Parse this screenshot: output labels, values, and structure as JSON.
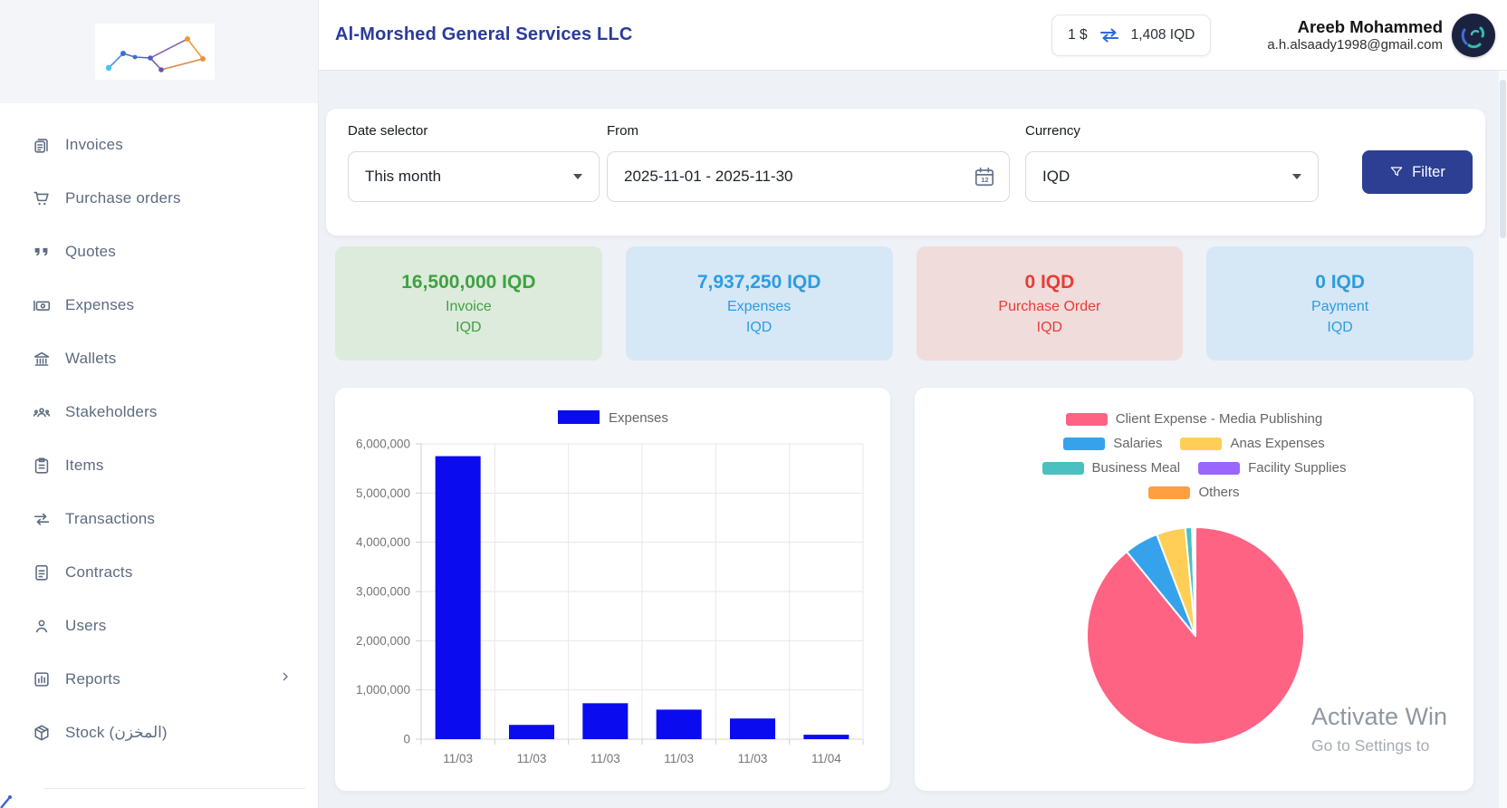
{
  "colors": {
    "title_navy": "#2a3b9c",
    "filter_button": "#2c3f92",
    "bar_blue": "#0b0bf0",
    "stat_green": "#3fa142",
    "stat_blue": "#2d9ce0",
    "stat_red": "#e83d35",
    "pie_palette": [
      "#FF6384",
      "#36A2EB",
      "#FFCE56",
      "#4BC0C0",
      "#9966FF",
      "#FF9F40"
    ]
  },
  "header": {
    "company_name": "Al-Morshed General Services LLC",
    "exchange_rate": {
      "left": "1 $",
      "right": "1,408 IQD"
    },
    "user": {
      "name": "Areeb Mohammed",
      "email": "a.h.alsaady1998@gmail.com"
    }
  },
  "sidebar": {
    "items": [
      {
        "label": "Invoices",
        "icon": "invoices-icon"
      },
      {
        "label": "Purchase orders",
        "icon": "purchase-orders-icon"
      },
      {
        "label": "Quotes",
        "icon": "quotes-icon"
      },
      {
        "label": "Expenses",
        "icon": "expenses-icon"
      },
      {
        "label": "Wallets",
        "icon": "wallets-icon"
      },
      {
        "label": "Stakeholders",
        "icon": "stakeholders-icon"
      },
      {
        "label": "Items",
        "icon": "items-icon"
      },
      {
        "label": "Transactions",
        "icon": "transactions-icon"
      },
      {
        "label": "Contracts",
        "icon": "contracts-icon"
      },
      {
        "label": "Users",
        "icon": "users-icon"
      },
      {
        "label": "Reports",
        "icon": "reports-icon",
        "chevron": true
      },
      {
        "label": "Stock (المخزن)",
        "icon": "stock-icon"
      }
    ]
  },
  "filters": {
    "date_selector": {
      "label": "Date selector",
      "value": "This month"
    },
    "from": {
      "label": "From",
      "value": "2025-11-01 - 2025-11-30"
    },
    "currency": {
      "label": "Currency",
      "value": "IQD"
    },
    "filter_button_label": "Filter"
  },
  "stat_cards": [
    {
      "value": "16,500,000 IQD",
      "label": "Invoice",
      "currency": "IQD",
      "theme": "green"
    },
    {
      "value": "7,937,250 IQD",
      "label": "Expenses",
      "currency": "IQD",
      "theme": "blue"
    },
    {
      "value": "0 IQD",
      "label": "Purchase Order",
      "currency": "IQD",
      "theme": "red"
    },
    {
      "value": "0 IQD",
      "label": "Payment",
      "currency": "IQD",
      "theme": "blue"
    }
  ],
  "watermark": {
    "line1": "Activate Win",
    "line2": "Go to Settings to"
  },
  "chart_data": [
    {
      "type": "bar",
      "title": "",
      "legend_position": "top",
      "categories": [
        "11/03",
        "11/03",
        "11/03",
        "11/03",
        "11/03",
        "11/04"
      ],
      "series": [
        {
          "name": "Expenses",
          "values": [
            5750000,
            290000,
            730000,
            600000,
            420000,
            90000
          ],
          "color": "#0b0bf0"
        }
      ],
      "xlabel": "",
      "ylabel": "",
      "ylim": [
        0,
        6000000
      ],
      "ytick_step": 1000000,
      "grid": true
    },
    {
      "type": "pie",
      "legend_position": "top",
      "labels": [
        "Client Expense - Media Publishing",
        "Salaries",
        "Anas Expenses",
        "Business Meal",
        "Facility Supplies",
        "Others"
      ],
      "values_pct": [
        89.1,
        5.1,
        4.3,
        1.0,
        0.3,
        0.2
      ],
      "colors": [
        "#FF6384",
        "#36A2EB",
        "#FFCE56",
        "#4BC0C0",
        "#9966FF",
        "#FF9F40"
      ]
    }
  ]
}
